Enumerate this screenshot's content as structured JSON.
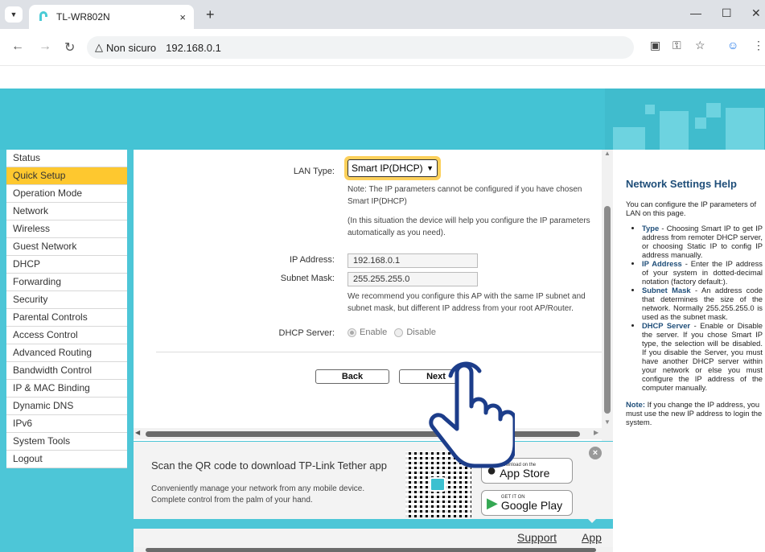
{
  "browser": {
    "tab_title": "TL-WR802N",
    "security_label": "Non sicuro",
    "url": "192.168.0.1",
    "new_tab": "+",
    "tab_close": "×"
  },
  "menu": {
    "items": [
      {
        "label": "Status"
      },
      {
        "label": "Quick Setup",
        "active": true
      },
      {
        "label": "Operation Mode"
      },
      {
        "label": "Network"
      },
      {
        "label": "Wireless"
      },
      {
        "label": "Guest Network"
      },
      {
        "label": "DHCP"
      },
      {
        "label": "Forwarding"
      },
      {
        "label": "Security"
      },
      {
        "label": "Parental Controls"
      },
      {
        "label": "Access Control"
      },
      {
        "label": "Advanced Routing"
      },
      {
        "label": "Bandwidth Control"
      },
      {
        "label": "IP & MAC Binding"
      },
      {
        "label": "Dynamic DNS"
      },
      {
        "label": "IPv6"
      },
      {
        "label": "System Tools"
      },
      {
        "label": "Logout"
      }
    ]
  },
  "form": {
    "lan_type_label": "LAN Type:",
    "lan_type_value": "Smart IP(DHCP)",
    "note1": "Note: The IP parameters cannot be configured if you have chosen Smart IP(DHCP)",
    "note2": "(In this situation the device will help you configure the IP parameters automatically as you need).",
    "ip_label": "IP Address:",
    "ip_value": "192.168.0.1",
    "mask_label": "Subnet Mask:",
    "mask_value": "255.255.255.0",
    "recommend": "We recommend you configure this AP with the same IP subnet and subnet mask, but different IP address from your root AP/Router.",
    "dhcp_label": "DHCP Server:",
    "dhcp_enable": "Enable",
    "dhcp_disable": "Disable",
    "back": "Back",
    "next": "Next"
  },
  "promo": {
    "title": "Scan the QR code to download TP-Link Tether app",
    "sub": "Conveniently manage your network from any mobile device. Complete control from the palm of your hand.",
    "appstore_small": "Download on the",
    "appstore_big": "App Store",
    "googleplay_small": "GET IT ON",
    "googleplay_big": "Google Play"
  },
  "footer": {
    "support": "Support",
    "app": "App"
  },
  "help": {
    "title": "Network Settings Help",
    "intro": "You can configure the IP parameters of LAN on this page.",
    "items": [
      {
        "term": "Type",
        "text": " - Choosing Smart IP to get IP address from remoter DHCP server, or choosing Static IP to config IP address manually."
      },
      {
        "term": "IP Address",
        "text": " - Enter the IP address of your system in dotted-decimal notation (factory default:)."
      },
      {
        "term": "Subnet Mask",
        "text": " - An address code that determines the size of the network. Normally 255.255.255.0 is used as the subnet mask."
      },
      {
        "term": "DHCP Server",
        "text": " - Enable or Disable the server. If you chose Smart IP type, the selection will be disabled. If you disable the Server, you must have another DHCP server within your network or else you must configure the IP address of the computer manually."
      }
    ],
    "note_term": "Note:",
    "note_text": " If you change the IP address, you must use the new IP address to login the system."
  }
}
